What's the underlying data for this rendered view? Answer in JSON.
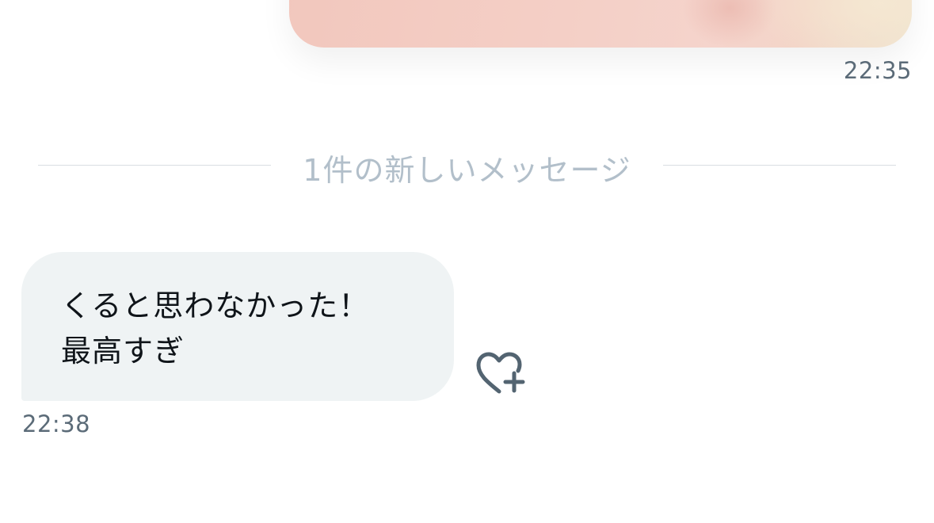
{
  "sent_message": {
    "type": "image",
    "time": "22:35"
  },
  "divider": {
    "label": "1件の新しいメッセージ"
  },
  "received_message": {
    "text": "くると思わなかった！\n最高すぎ",
    "time": "22:38",
    "reaction_icon": "heart-plus-icon"
  },
  "colors": {
    "bubble_background": "#eff3f4",
    "timestamp": "#5b6b78",
    "divider_text": "#b2bfca",
    "icon": "#536471"
  }
}
